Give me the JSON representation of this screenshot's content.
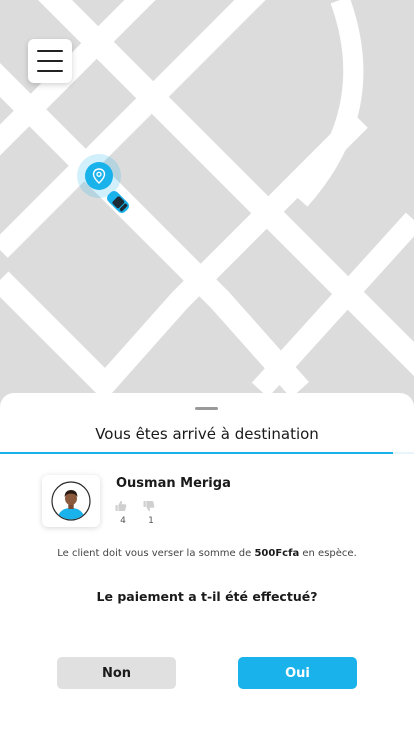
{
  "colors": {
    "accent": "#1ab2ea",
    "map_background": "#dcdcdc",
    "road": "#ffffff"
  },
  "map": {
    "menu_icon": "hamburger-menu-icon",
    "location_icon": "location-pin-icon",
    "vehicle_icon": "car-icon"
  },
  "sheet": {
    "title": "Vous êtes arrivé à destination",
    "progress": 0.95,
    "client": {
      "name": "Ousman Meriga",
      "avatar_icon": "user-avatar-icon",
      "likes": "4",
      "dislikes": "1"
    },
    "info": {
      "prefix": "Le client doit vous verser la somme de",
      "amount": "500Fcfa",
      "suffix": "en espèce."
    },
    "question": "Le paiement a t-il été effectué?",
    "buttons": {
      "no": "Non",
      "yes": "Oui"
    }
  }
}
